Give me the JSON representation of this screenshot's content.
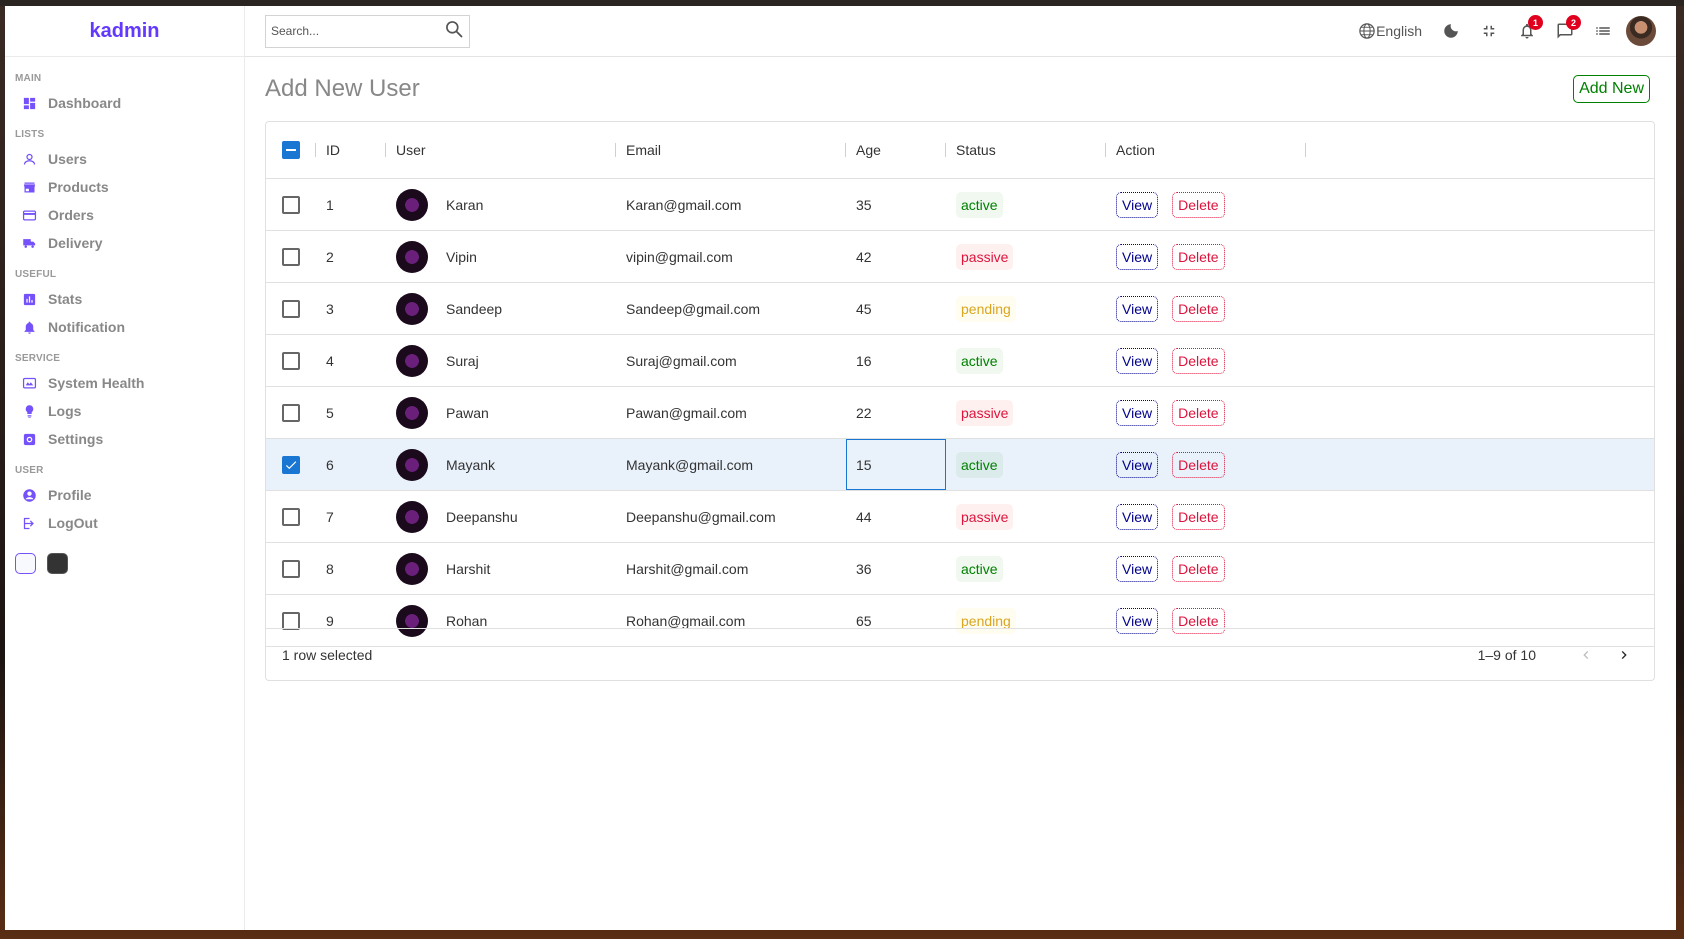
{
  "app": {
    "logo": "kadmin"
  },
  "sidebar": {
    "sections": [
      {
        "title": "MAIN",
        "items": [
          {
            "label": "Dashboard",
            "icon": "dashboard-icon"
          }
        ]
      },
      {
        "title": "LISTS",
        "items": [
          {
            "label": "Users",
            "icon": "person-icon"
          },
          {
            "label": "Products",
            "icon": "store-icon"
          },
          {
            "label": "Orders",
            "icon": "credit-card-icon"
          },
          {
            "label": "Delivery",
            "icon": "truck-icon"
          }
        ]
      },
      {
        "title": "USEFUL",
        "items": [
          {
            "label": "Stats",
            "icon": "chart-icon"
          },
          {
            "label": "Notification",
            "icon": "bell-icon"
          }
        ]
      },
      {
        "title": "SERVICE",
        "items": [
          {
            "label": "System Health",
            "icon": "health-icon"
          },
          {
            "label": "Logs",
            "icon": "brain-icon"
          },
          {
            "label": "Settings",
            "icon": "settings-icon"
          }
        ]
      },
      {
        "title": "USER",
        "items": [
          {
            "label": "Profile",
            "icon": "account-circle-icon"
          },
          {
            "label": "LogOut",
            "icon": "logout-icon"
          }
        ]
      }
    ]
  },
  "navbar": {
    "search_placeholder": "Search...",
    "language": "English",
    "notifications_count": "1",
    "messages_count": "2"
  },
  "page": {
    "title": "Add New User",
    "add_button": "Add New"
  },
  "table": {
    "columns": [
      "ID",
      "User",
      "Email",
      "Age",
      "Status",
      "Action"
    ],
    "view_label": "View",
    "delete_label": "Delete",
    "rows": [
      {
        "id": "1",
        "user": "Karan",
        "email": "Karan@gmail.com",
        "age": "35",
        "status": "active",
        "selected": false
      },
      {
        "id": "2",
        "user": "Vipin",
        "email": "vipin@gmail.com",
        "age": "42",
        "status": "passive",
        "selected": false
      },
      {
        "id": "3",
        "user": "Sandeep",
        "email": "Sandeep@gmail.com",
        "age": "45",
        "status": "pending",
        "selected": false
      },
      {
        "id": "4",
        "user": "Suraj",
        "email": "Suraj@gmail.com",
        "age": "16",
        "status": "active",
        "selected": false
      },
      {
        "id": "5",
        "user": "Pawan",
        "email": "Pawan@gmail.com",
        "age": "22",
        "status": "passive",
        "selected": false
      },
      {
        "id": "6",
        "user": "Mayank",
        "email": "Mayank@gmail.com",
        "age": "15",
        "status": "active",
        "selected": true
      },
      {
        "id": "7",
        "user": "Deepanshu",
        "email": "Deepanshu@gmail.com",
        "age": "44",
        "status": "passive",
        "selected": false
      },
      {
        "id": "8",
        "user": "Harshit",
        "email": "Harshit@gmail.com",
        "age": "36",
        "status": "active",
        "selected": false
      },
      {
        "id": "9",
        "user": "Rohan",
        "email": "Rohan@gmail.com",
        "age": "65",
        "status": "pending",
        "selected": false
      }
    ],
    "footer_selected": "1 row selected",
    "footer_range": "1–9 of 10"
  }
}
